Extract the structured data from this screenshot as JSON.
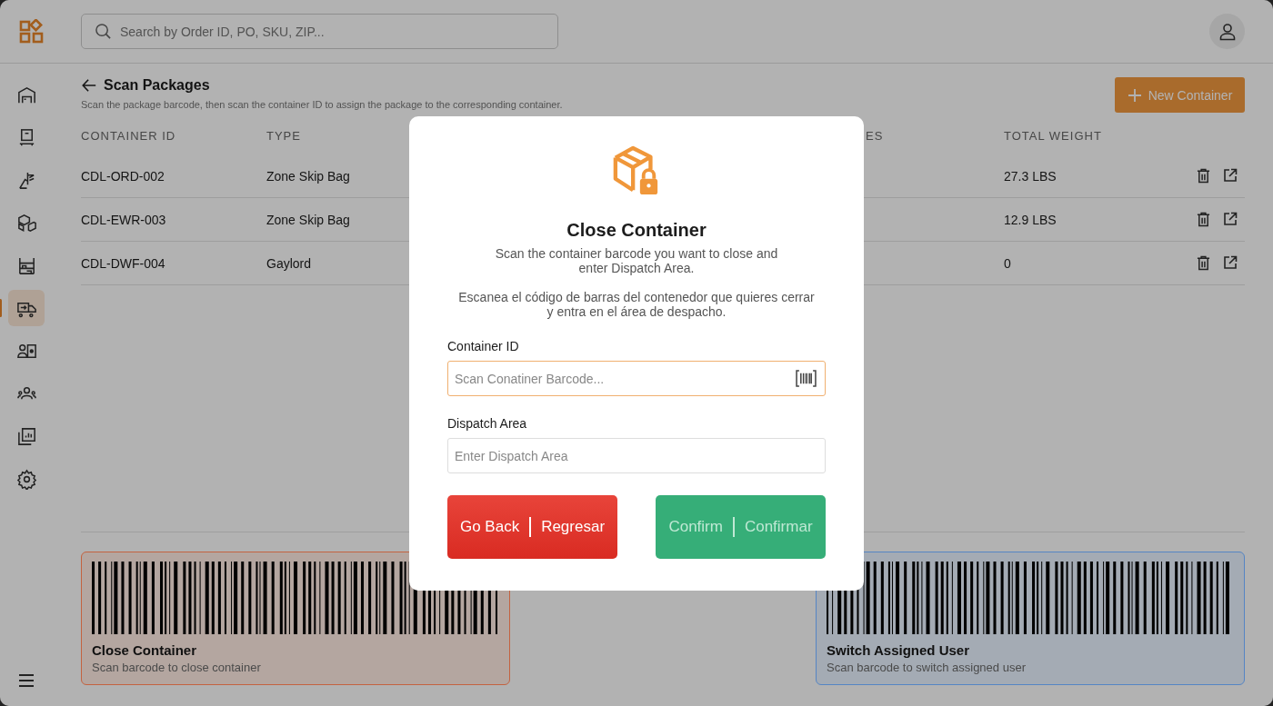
{
  "header": {
    "search": {
      "placeholder": "Search by Order ID, PO, SKU, ZIP..."
    }
  },
  "sidebar": {
    "items": [
      {
        "selected": false
      },
      {
        "selected": false
      },
      {
        "selected": false
      },
      {
        "selected": false
      },
      {
        "selected": false
      },
      {
        "selected": true
      },
      {
        "selected": false
      },
      {
        "selected": false
      },
      {
        "selected": false
      },
      {
        "selected": false
      }
    ]
  },
  "page": {
    "title": "Scan Packages",
    "subtitle": "Scan the package barcode, then scan the container ID to assign the package to the corresponding container.",
    "new_button": "New Container"
  },
  "table": {
    "columns": [
      "CONTAINER ID",
      "TYPE",
      "",
      "ES",
      "TOTAL WEIGHT"
    ],
    "rows": [
      {
        "container_id": "CDL-ORD-002",
        "type": "Zone Skip Bag",
        "total_weight": "27.3 LBS"
      },
      {
        "container_id": "CDL-EWR-003",
        "type": "Zone Skip Bag",
        "total_weight": "12.9 LBS"
      },
      {
        "container_id": "CDL-DWF-004",
        "type": "Gaylord",
        "total_weight": "0"
      }
    ]
  },
  "barcode_cards": [
    {
      "title": "Close Container",
      "caption": "Scan barcode to close container",
      "color": "#c4623f"
    },
    {
      "title": "Switch Assigned User",
      "caption": "Scan barcode to switch assigned user",
      "color": "#5585c4"
    }
  ],
  "dialog": {
    "title": "Close Container",
    "text_en": "Scan the container barcode you want to close and enter Dispatch Area.",
    "text_es": "Escanea el código de barras del contenedor que quieres cerrar y entra en el área de despacho.",
    "fields": [
      {
        "label": "Container ID",
        "placeholder": "Scan Conatiner Barcode...",
        "focused": true,
        "kind": "scan"
      },
      {
        "label": "Dispatch Area",
        "placeholder": "Enter Dispatch Area",
        "focused": false,
        "kind": "text"
      }
    ],
    "buttons": [
      {
        "kind": "cancel",
        "label": "Go Back",
        "label_es": "Regresar",
        "disabled": false
      },
      {
        "kind": "confirm",
        "label": "Confirm",
        "label_es": "Confirmar",
        "disabled": true
      }
    ]
  }
}
